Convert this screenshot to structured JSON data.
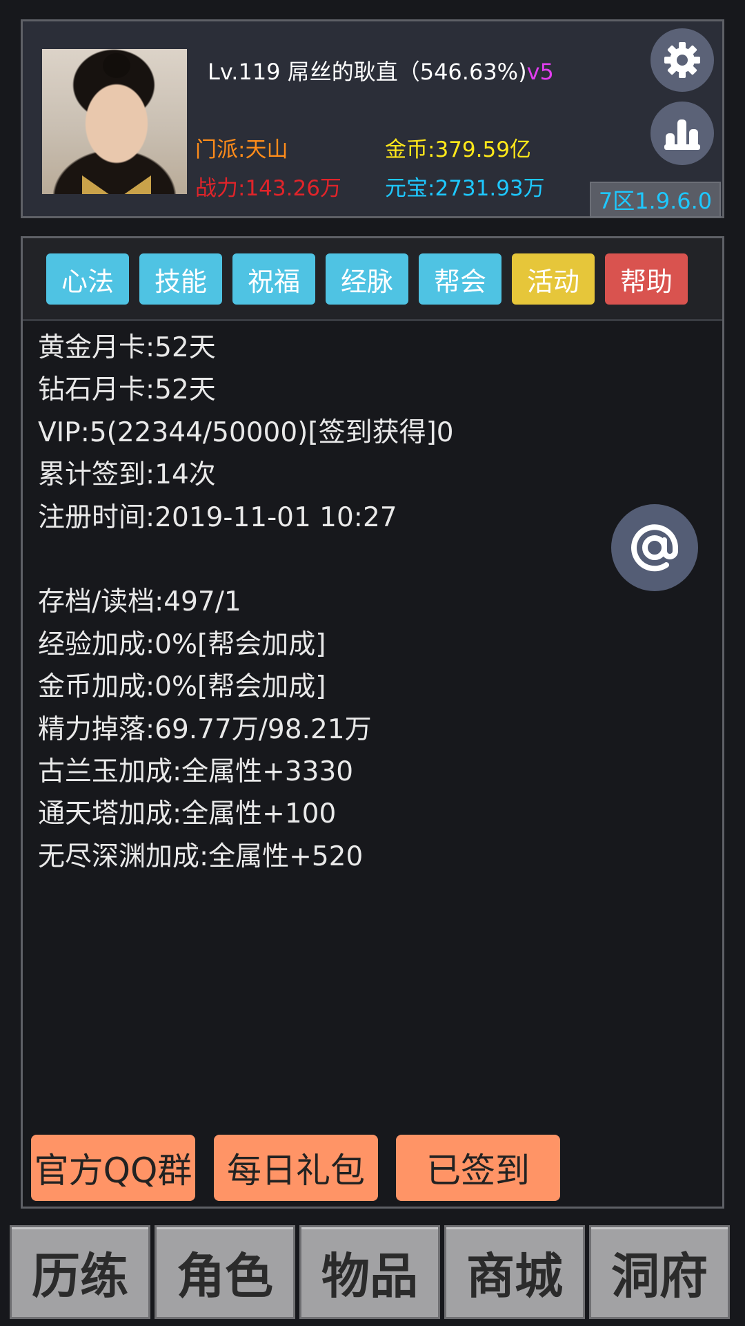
{
  "profile": {
    "title": "Lv.119 屌丝的耿直（546.63%)",
    "vip": "v5",
    "sect": "门派:天山",
    "gold": "金币:379.59亿",
    "power": "战力:143.26万",
    "ingot": "元宝:2731.93万",
    "server": "7区1.9.6.0",
    "settings_icon": "gear-icon",
    "stats_icon": "bar-chart-icon"
  },
  "tabs": [
    {
      "label": "心法",
      "color": "#4fc3e3"
    },
    {
      "label": "技能",
      "color": "#4fc3e3"
    },
    {
      "label": "祝福",
      "color": "#4fc3e3"
    },
    {
      "label": "经脉",
      "color": "#4fc3e3"
    },
    {
      "label": "帮会",
      "color": "#4fc3e3"
    },
    {
      "label": "活动",
      "color": "#e6c63a"
    },
    {
      "label": "帮助",
      "color": "#d9534f"
    }
  ],
  "info": [
    "黄金月卡:52天",
    "钻石月卡:52天",
    "VIP:5(22344/50000)[签到获得]0",
    "累计签到:14次",
    "注册时间:2019-11-01 10:27",
    "",
    "存档/读档:497/1",
    "经验加成:0%[帮会加成]",
    "金币加成:0%[帮会加成]",
    "精力掉落:69.77万/98.21万",
    "古兰玉加成:全属性+3330",
    "通天塔加成:全属性+100",
    "无尽深渊加成:全属性+520"
  ],
  "mention_icon": "at-icon",
  "actions": {
    "qq_group": "官方QQ群",
    "daily_gift": "每日礼包",
    "signed_in": "已签到"
  },
  "nav": [
    "历练",
    "角色",
    "物品",
    "商城",
    "洞府"
  ]
}
